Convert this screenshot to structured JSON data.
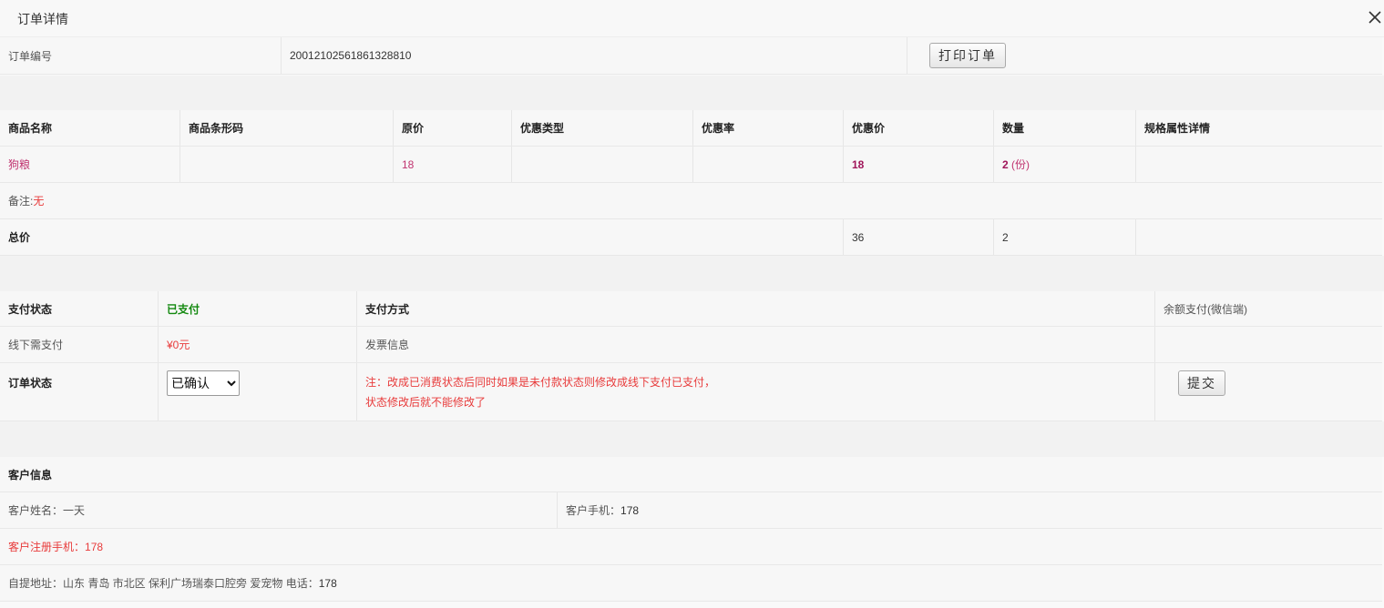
{
  "dialog": {
    "title": "订单详情"
  },
  "order_no": {
    "label": "订单编号",
    "value": "20012102561861328810",
    "print_button": "打印订单"
  },
  "goods_table": {
    "headers": [
      "商品名称",
      "商品条形码",
      "原价",
      "优惠类型",
      "优惠率",
      "优惠价",
      "数量",
      "规格属性详情"
    ],
    "rows": [
      {
        "name": "狗粮",
        "barcode": "",
        "price": "18",
        "discount_type": "",
        "discount_rate": "",
        "discount_price": "18",
        "qty": "2",
        "qty_unit": "(份)",
        "spec": ""
      }
    ],
    "remark_label": "备注:",
    "remark_value": "无",
    "total_label": "总价",
    "total_price": "36",
    "total_qty": "2"
  },
  "payment": {
    "status_label": "支付状态",
    "status_value": "已支付",
    "method_label": "支付方式",
    "method_value": "余额支付(微信端)",
    "offline_label": "线下需支付",
    "offline_value": "¥0元",
    "invoice_label": "发票信息",
    "order_status_label": "订单状态",
    "order_status_value": "已确认",
    "order_status_options": [
      "已确认"
    ],
    "note_line1": "注：改成已消费状态后同时如果是未付款状态则修改成线下支付已支付，",
    "note_line2": "状态修改后就不能修改了",
    "submit_button": "提交"
  },
  "customer": {
    "section_title": "客户信息",
    "name_label": "客户姓名：",
    "name_value": "一天",
    "phone_label": "客户手机：",
    "phone_value": "178",
    "reg_phone_label": "客户注册手机：",
    "reg_phone_value": "178",
    "address_label": "自提地址：",
    "address_value": "山东 青岛 市北区 保利广场瑞泰口腔旁 爱宠物",
    "tel_label": "电话：",
    "tel_value": "178"
  },
  "icons": {
    "close": "close-icon"
  }
}
